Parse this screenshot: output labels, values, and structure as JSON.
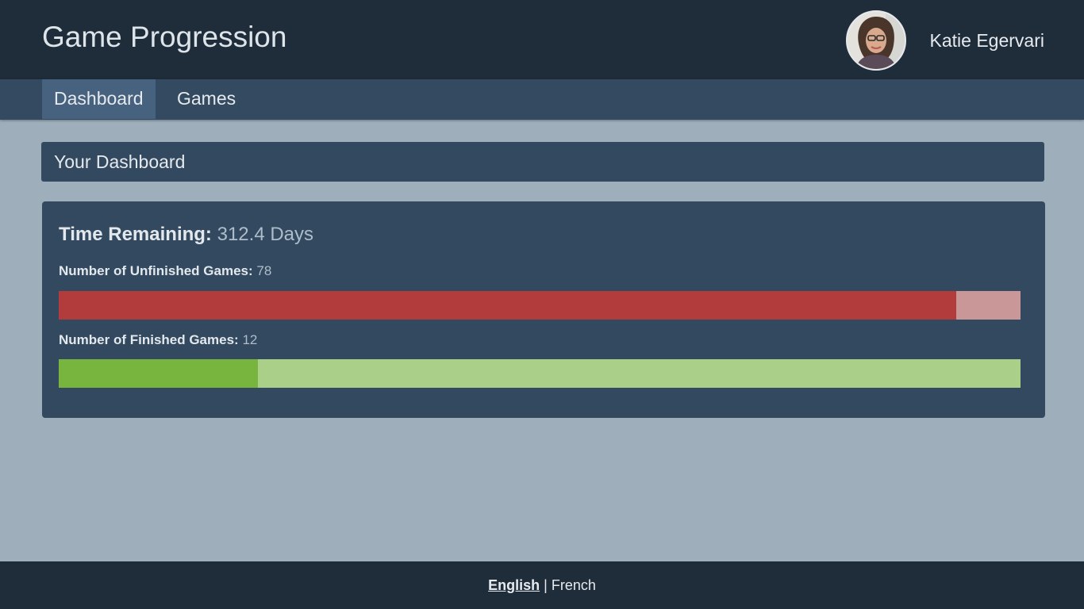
{
  "header": {
    "app_title": "Game Progression",
    "user_name": "Katie Egervari",
    "avatar_icon": "user-avatar-photo"
  },
  "nav": {
    "tabs": [
      {
        "label": "Dashboard",
        "active": true
      },
      {
        "label": "Games",
        "active": false
      }
    ]
  },
  "main": {
    "panel_title": "Your Dashboard",
    "time_remaining": {
      "label": "Time Remaining:",
      "value": "312.4 Days"
    },
    "unfinished": {
      "label": "Number of Unfinished Games:",
      "value": "78",
      "bar_fraction": 0.933
    },
    "finished": {
      "label": "Number of Finished Games:",
      "value": "12",
      "bar_fraction": 0.207
    }
  },
  "footer": {
    "languages": [
      {
        "label": "English",
        "active": true
      },
      {
        "label": "French",
        "active": false
      }
    ],
    "separator": "|"
  },
  "colors": {
    "topbar": "#1f2d3b",
    "navbar": "#334a61",
    "background": "#9eaebb",
    "unfinished_bar": "#b23b3c",
    "unfinished_track": "#c99797",
    "finished_bar": "#78b53e",
    "finished_track": "#a9cf88"
  }
}
